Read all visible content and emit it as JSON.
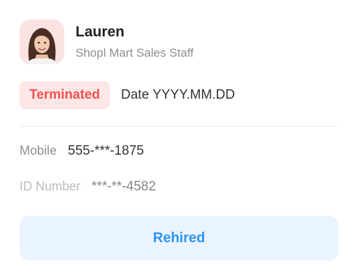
{
  "employee": {
    "name": "Lauren",
    "role": "Shopl Mart Sales Staff",
    "avatar_icon": "user-photo"
  },
  "status": {
    "badge": "Terminated",
    "date": "Date YYYY.MM.DD",
    "badge_color": "#f05252",
    "badge_bg": "#fde6e6"
  },
  "details": {
    "mobile_label": "Mobile",
    "mobile_value": "555-***-1875",
    "id_label": "ID Number",
    "id_value": "***-**-4582"
  },
  "actions": {
    "rehire_label": "Rehired",
    "accent": "#2f95f2"
  }
}
